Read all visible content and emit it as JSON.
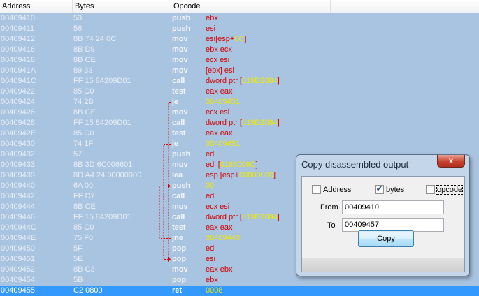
{
  "columns": {
    "address": "Address",
    "bytes": "Bytes",
    "opcode": "Opcode"
  },
  "rows": [
    {
      "addr": "00409410",
      "bytes": "53",
      "mn": "push",
      "ops": [
        {
          "t": "ebx",
          "c": "r"
        }
      ]
    },
    {
      "addr": "00409411",
      "bytes": "56",
      "mn": "push",
      "ops": [
        {
          "t": "esi",
          "c": "r"
        }
      ]
    },
    {
      "addr": "00409412",
      "bytes": "8B 74 24 0C",
      "mn": "mov",
      "ops": [
        {
          "t": "esi",
          "c": "r"
        },
        {
          "t": "[",
          "c": "r"
        },
        {
          "t": "esp",
          "c": "r"
        },
        {
          "t": "+",
          "c": "r"
        },
        {
          "t": "0C",
          "c": "y"
        },
        {
          "t": "]",
          "c": "r"
        }
      ]
    },
    {
      "addr": "00409416",
      "bytes": "8B D9",
      "mn": "mov",
      "ops": [
        {
          "t": "ebx ecx",
          "c": "r"
        }
      ]
    },
    {
      "addr": "00409418",
      "bytes": "8B CE",
      "mn": "mov",
      "ops": [
        {
          "t": "ecx esi",
          "c": "r"
        }
      ]
    },
    {
      "addr": "0040941A",
      "bytes": "89 33",
      "mn": "mov",
      "ops": [
        {
          "t": "[ebx] esi",
          "c": "r"
        }
      ]
    },
    {
      "addr": "0040941C",
      "bytes": "FF 15 84209D01",
      "mn": "call",
      "ops": [
        {
          "t": "dword ptr [",
          "c": "r"
        },
        {
          "t": "019D2084",
          "c": "y"
        },
        {
          "t": "]",
          "c": "r"
        }
      ]
    },
    {
      "addr": "00409422",
      "bytes": "85 C0",
      "mn": "test",
      "ops": [
        {
          "t": "eax eax",
          "c": "r"
        }
      ]
    },
    {
      "addr": "00409424",
      "bytes": "74 2B",
      "mn": "je",
      "ops": [
        {
          "t": "00409451",
          "c": "y"
        }
      ]
    },
    {
      "addr": "00409426",
      "bytes": "8B CE",
      "mn": "mov",
      "ops": [
        {
          "t": "ecx esi",
          "c": "r"
        }
      ]
    },
    {
      "addr": "00409428",
      "bytes": "FF 15 84209D01",
      "mn": "call",
      "ops": [
        {
          "t": "dword ptr [",
          "c": "r"
        },
        {
          "t": "019D2084",
          "c": "y"
        },
        {
          "t": "]",
          "c": "r"
        }
      ]
    },
    {
      "addr": "0040942E",
      "bytes": "85 C0",
      "mn": "test",
      "ops": [
        {
          "t": "eax eax",
          "c": "r"
        }
      ]
    },
    {
      "addr": "00409430",
      "bytes": "74 1F",
      "mn": "je",
      "ops": [
        {
          "t": "00409451",
          "c": "y"
        }
      ]
    },
    {
      "addr": "00409432",
      "bytes": "57",
      "mn": "push",
      "ops": [
        {
          "t": "edi",
          "c": "r"
        }
      ]
    },
    {
      "addr": "00409433",
      "bytes": "8B 3D 6C006601",
      "mn": "mov",
      "ops": [
        {
          "t": "edi [",
          "c": "r"
        },
        {
          "t": "0166006C",
          "c": "y"
        },
        {
          "t": "]",
          "c": "r"
        }
      ]
    },
    {
      "addr": "00409439",
      "bytes": "8D A4 24 00000000",
      "mn": "lea",
      "ops": [
        {
          "t": "esp [esp+",
          "c": "r"
        },
        {
          "t": "00000000",
          "c": "y"
        },
        {
          "t": "]",
          "c": "r"
        }
      ]
    },
    {
      "addr": "00409440",
      "bytes": "6A 00",
      "mn": "push",
      "ops": [
        {
          "t": "00",
          "c": "y"
        }
      ]
    },
    {
      "addr": "00409442",
      "bytes": "FF D7",
      "mn": "call",
      "ops": [
        {
          "t": "edi",
          "c": "r"
        }
      ]
    },
    {
      "addr": "00409444",
      "bytes": "8B CE",
      "mn": "mov",
      "ops": [
        {
          "t": "ecx esi",
          "c": "r"
        }
      ]
    },
    {
      "addr": "00409446",
      "bytes": "FF 15 84209D01",
      "mn": "call",
      "ops": [
        {
          "t": "dword ptr [",
          "c": "r"
        },
        {
          "t": "019D2084",
          "c": "y"
        },
        {
          "t": "]",
          "c": "r"
        }
      ]
    },
    {
      "addr": "0040944C",
      "bytes": "85 C0",
      "mn": "test",
      "ops": [
        {
          "t": "eax eax",
          "c": "r"
        }
      ]
    },
    {
      "addr": "0040944E",
      "bytes": "75 F0",
      "mn": "jne",
      "ops": [
        {
          "t": "00409440",
          "c": "y"
        }
      ]
    },
    {
      "addr": "00409450",
      "bytes": "5F",
      "mn": "pop",
      "ops": [
        {
          "t": "edi",
          "c": "r"
        }
      ]
    },
    {
      "addr": "00409451",
      "bytes": "5E",
      "mn": "pop",
      "ops": [
        {
          "t": "esi",
          "c": "r"
        }
      ]
    },
    {
      "addr": "00409452",
      "bytes": "8B C3",
      "mn": "mov",
      "ops": [
        {
          "t": "eax ebx",
          "c": "r"
        }
      ]
    },
    {
      "addr": "00409454",
      "bytes": "5B",
      "mn": "pop",
      "ops": [
        {
          "t": "ebx",
          "c": "r"
        }
      ]
    },
    {
      "addr": "00409455",
      "bytes": "C2 0800",
      "mn": "ret",
      "ops": [
        {
          "t": "0008",
          "c": "y"
        }
      ],
      "selected": true
    }
  ],
  "jumps": [
    {
      "from": 8,
      "to": 23
    },
    {
      "from": 12,
      "to": 23
    },
    {
      "from": 21,
      "to": 16
    }
  ],
  "dialog": {
    "title": "Copy disassembled output",
    "close_glyph": "x",
    "options": [
      {
        "label": "Address",
        "checked": false
      },
      {
        "label": "bytes",
        "checked": true
      },
      {
        "label": "opcode",
        "checked": false
      }
    ],
    "from_label": "From",
    "from_value": "00409410",
    "to_label": "To",
    "to_value": "00409457",
    "copy_label": "Copy"
  },
  "colors": {
    "operand_red": "#d30000",
    "operand_yellow": "#f0e800",
    "jump_arrow": "#e00000",
    "selection": "#3399ff",
    "background": "#a9c4e0"
  }
}
